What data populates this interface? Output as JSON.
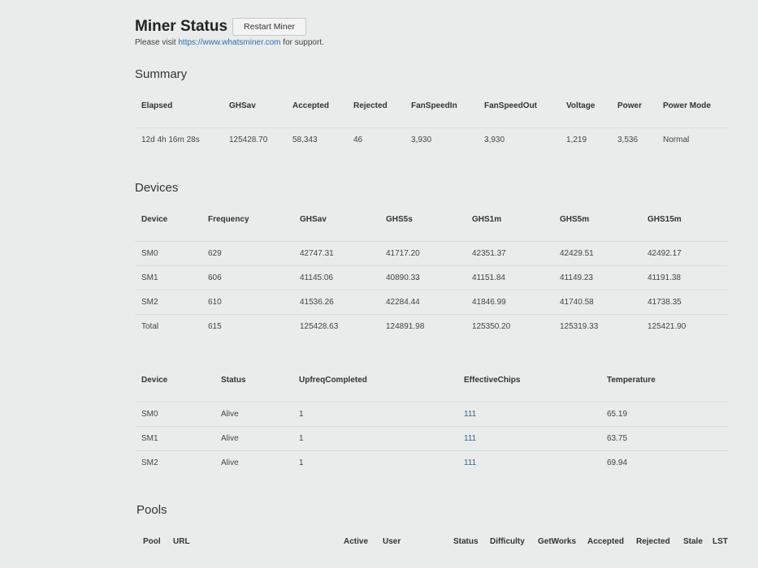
{
  "header": {
    "title": "Miner Status",
    "restart_label": "Restart Miner",
    "support_prefix": "Please visit ",
    "support_link": "https://www.whatsminer.com",
    "support_suffix": " for support."
  },
  "summary": {
    "title": "Summary",
    "columns": [
      "Elapsed",
      "GHSav",
      "Accepted",
      "Rejected",
      "FanSpeedIn",
      "FanSpeedOut",
      "Voltage",
      "Power",
      "Power Mode"
    ],
    "row": [
      "12d 4h 16m 28s",
      "125428.70",
      "58,343",
      "46",
      "3,930",
      "3,930",
      "1,219",
      "3,536",
      "Normal"
    ]
  },
  "devices": {
    "title": "Devices",
    "columns": [
      "Device",
      "Frequency",
      "GHSav",
      "GHS5s",
      "GHS1m",
      "GHS5m",
      "GHS15m"
    ],
    "rows": [
      [
        "SM0",
        "629",
        "42747.31",
        "41717.20",
        "42351.37",
        "42429.51",
        "42492.17"
      ],
      [
        "SM1",
        "606",
        "41145.06",
        "40890.33",
        "41151.84",
        "41149.23",
        "41191.38"
      ],
      [
        "SM2",
        "610",
        "41536.26",
        "42284.44",
        "41846.99",
        "41740.58",
        "41738.35"
      ],
      [
        "Total",
        "615",
        "125428.63",
        "124891.98",
        "125350.20",
        "125319.33",
        "125421.90"
      ]
    ]
  },
  "device_status": {
    "columns": [
      "Device",
      "Status",
      "UpfreqCompleted",
      "EffectiveChips",
      "Temperature"
    ],
    "rows": [
      [
        "SM0",
        "Alive",
        "1",
        "111",
        "65.19"
      ],
      [
        "SM1",
        "Alive",
        "1",
        "111",
        "63.75"
      ],
      [
        "SM2",
        "Alive",
        "1",
        "111",
        "69.94"
      ]
    ]
  },
  "pools": {
    "title": "Pools",
    "columns": [
      "Pool",
      "URL",
      "Active",
      "User",
      "Status",
      "Difficulty",
      "GetWorks",
      "Accepted",
      "Rejected",
      "Stale",
      "LST"
    ]
  }
}
